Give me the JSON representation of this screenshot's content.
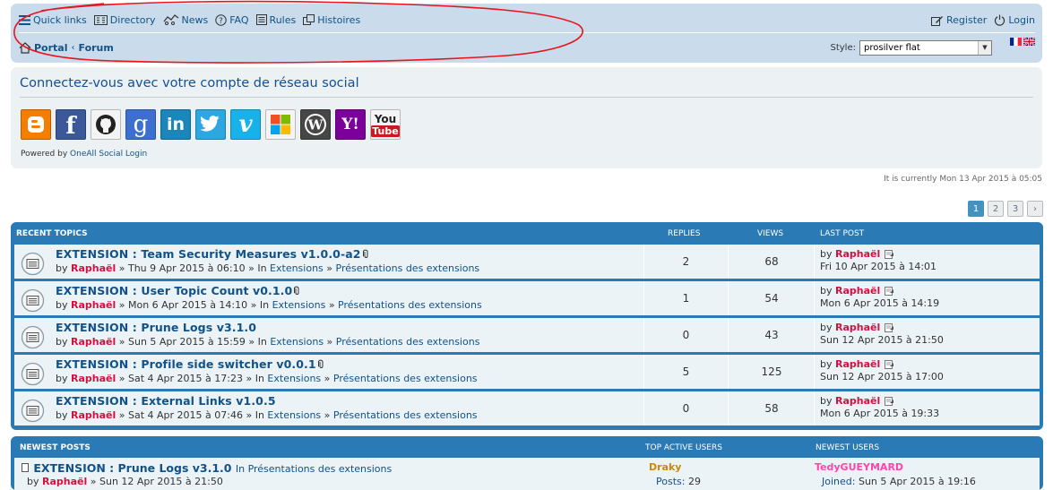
{
  "navbar": {
    "quick_links": "Quick links",
    "directory": "Directory",
    "news": "News",
    "faq": "FAQ",
    "rules": "Rules",
    "histoires": "Histoires",
    "register": "Register",
    "login": "Login",
    "breadcrumb_portal": "Portal",
    "breadcrumb_forum": "Forum",
    "style_label": "Style:",
    "style_value": "prosilver flat"
  },
  "social": {
    "title": "Connectez-vous avec votre compte de réseau social",
    "powered_prefix": "Powered by",
    "powered_link": "OneAll Social Login",
    "icons": [
      {
        "name": "blogger-icon",
        "glyph": "B",
        "color": "#f57d00"
      },
      {
        "name": "facebook-icon",
        "glyph": "f",
        "color": "#3b5998"
      },
      {
        "name": "github-icon",
        "glyph": "",
        "color": "#f4f4f4"
      },
      {
        "name": "google-icon",
        "glyph": "g",
        "color": "#3c6fcf"
      },
      {
        "name": "linkedin-icon",
        "glyph": "in",
        "color": "#1b86bc"
      },
      {
        "name": "twitter-icon",
        "glyph": "t",
        "color": "#2ca7e0"
      },
      {
        "name": "vimeo-icon",
        "glyph": "v",
        "color": "#17b3e8"
      },
      {
        "name": "windows-live-icon",
        "glyph": "",
        "color": "#f4f4f4"
      },
      {
        "name": "wordpress-icon",
        "glyph": "W",
        "color": "#464646"
      },
      {
        "name": "yahoo-icon",
        "glyph": "Y!",
        "color": "#7b0099"
      },
      {
        "name": "youtube-icon",
        "glyph": "You",
        "color": "#f4f4f4"
      }
    ]
  },
  "current_time": "It is currently Mon 13 Apr 2015 à 05:05",
  "pagination": [
    "1",
    "2",
    "3"
  ],
  "recent_topics": {
    "header": {
      "topics": "RECENT TOPICS",
      "replies": "REPLIES",
      "views": "VIEWS",
      "last_post": "LAST POST"
    },
    "rows": [
      {
        "title": "EXTENSION : Team Security Measures v1.0.0-a2",
        "attachment": true,
        "by": "by",
        "author": "Raphaël",
        "date": "» Thu 9 Apr 2015 à 06:10 » In",
        "forum1": "Extensions",
        "sep": "»",
        "forum2": "Présentations des extensions",
        "replies": "2",
        "views": "68",
        "last_by": "by",
        "last_author": "Raphaël",
        "last_date": "Fri 10 Apr 2015 à 14:01"
      },
      {
        "title": "EXTENSION : User Topic Count v0.1.0",
        "attachment": true,
        "by": "by",
        "author": "Raphaël",
        "date": "» Mon 6 Apr 2015 à 14:10 » In",
        "forum1": "Extensions",
        "sep": "»",
        "forum2": "Présentations des extensions",
        "replies": "1",
        "views": "54",
        "last_by": "by",
        "last_author": "Raphaël",
        "last_date": "Mon 6 Apr 2015 à 14:19"
      },
      {
        "title": "EXTENSION : Prune Logs v3.1.0",
        "attachment": false,
        "by": "by",
        "author": "Raphaël",
        "date": "» Sun 5 Apr 2015 à 15:59 » In",
        "forum1": "Extensions",
        "sep": "»",
        "forum2": "Présentations des extensions",
        "replies": "0",
        "views": "43",
        "last_by": "by",
        "last_author": "Raphaël",
        "last_date": "Sun 12 Apr 2015 à 21:50"
      },
      {
        "title": "EXTENSION : Profile side switcher v0.0.1",
        "attachment": true,
        "by": "by",
        "author": "Raphaël",
        "date": "» Sat 4 Apr 2015 à 17:23 » In",
        "forum1": "Extensions",
        "sep": "»",
        "forum2": "Présentations des extensions",
        "replies": "5",
        "views": "125",
        "last_by": "by",
        "last_author": "Raphaël",
        "last_date": "Sun 12 Apr 2015 à 17:00"
      },
      {
        "title": "EXTENSION : External Links v1.0.5",
        "attachment": false,
        "by": "by",
        "author": "Raphaël",
        "date": "» Sat 4 Apr 2015 à 07:46 » In",
        "forum1": "Extensions",
        "sep": "»",
        "forum2": "Présentations des extensions",
        "replies": "0",
        "views": "58",
        "last_by": "by",
        "last_author": "Raphaël",
        "last_date": "Mon 6 Apr 2015 à 19:33"
      }
    ]
  },
  "bottom": {
    "newest_posts_label": "NEWEST POSTS",
    "top_active_label": "TOP ACTIVE USERS",
    "newest_users_label": "NEWEST USERS",
    "post_title": "EXTENSION : Prune Logs v3.1.0",
    "post_in": "In Présentations des extensions",
    "post_by": "by",
    "post_author": "Raphaël",
    "post_date": "» Sun 12 Apr 2015 à 21:50",
    "top_user": "Draky",
    "top_posts_label": "Posts:",
    "top_posts_value": "29",
    "new_user": "TedyGUEYMARD",
    "joined_label": "Joined:",
    "joined_value": "Sun 5 Apr 2015 à 19:16"
  },
  "colors": {
    "link": "#105289",
    "author": "#d31141",
    "header_bg": "#2a7bb5",
    "navbar_bg": "#cadceb",
    "annotation": "#e8141e"
  }
}
